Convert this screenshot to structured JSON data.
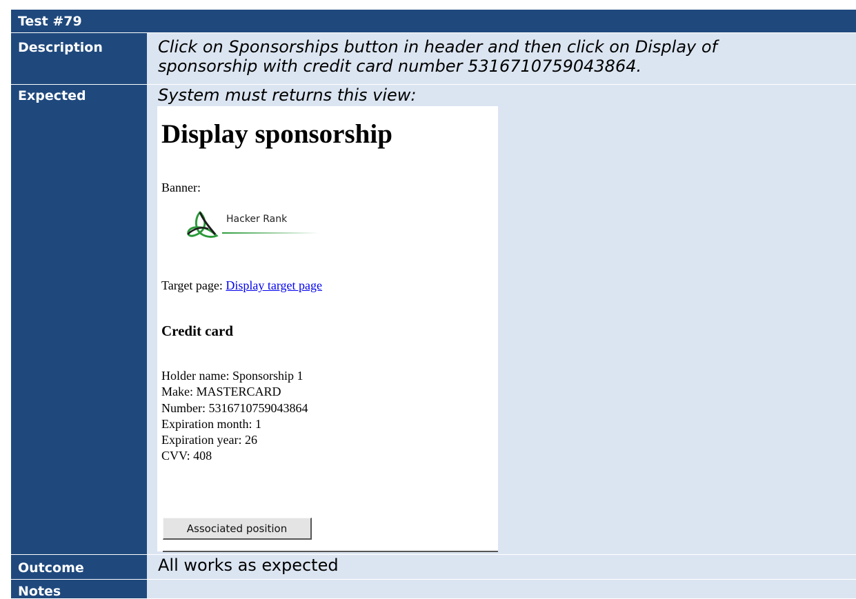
{
  "test": {
    "title": "Test #79",
    "labels": {
      "description": "Description",
      "expected": "Expected",
      "outcome": "Outcome",
      "notes": "Notes"
    },
    "description_lines": [
      "Click on Sponsorships button in header and then click on Display of",
      "sponsorship with credit card number 5316710759043864."
    ],
    "expected_intro": "System must returns this view:",
    "outcome": "All works as expected",
    "notes": ""
  },
  "screenshot": {
    "title": "Display sponsorship",
    "banner_label": "Banner:",
    "banner_brand": "Hacker Rank",
    "target_label": "Target page:",
    "target_link": "Display target page",
    "credit_heading": "Credit card",
    "credit_card": {
      "holder": "Holder name: Sponsorship 1",
      "make": "Make: MASTERCARD",
      "number": "Number: 5316710759043864",
      "exp_month": "Expiration month: 1",
      "exp_year": "Expiration year: 26",
      "cvv": "CVV: 408"
    },
    "button_label": "Associated position"
  },
  "colors": {
    "label_bg": "#1f497d",
    "content_bg": "#dbe5f1",
    "logo_green": "#2b9a3a"
  }
}
